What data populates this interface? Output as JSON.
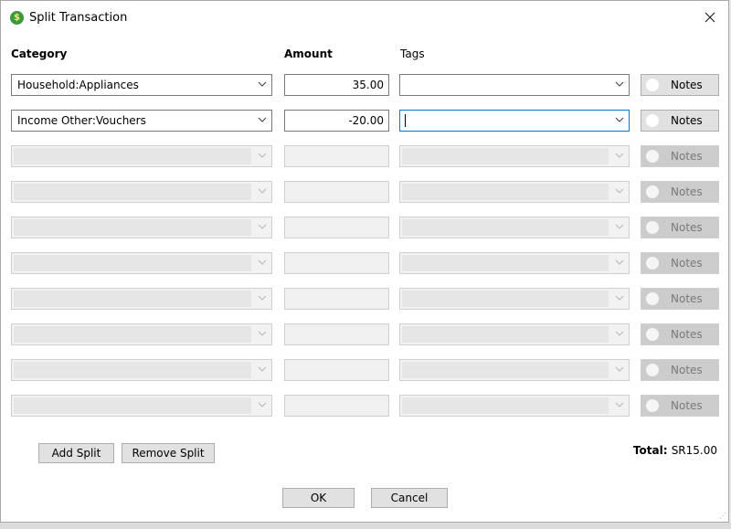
{
  "window": {
    "title": "Split Transaction",
    "icon": "dollar-coin-icon"
  },
  "headers": {
    "category": "Category",
    "amount": "Amount",
    "tags": "Tags"
  },
  "rows": [
    {
      "category": "Household:Appliances",
      "amount": "35.00",
      "tags": "",
      "notes": "Notes",
      "enabled": true
    },
    {
      "category": "Income Other:Vouchers",
      "amount": "-20.00",
      "tags": "",
      "notes": "Notes",
      "enabled": true,
      "focused": true
    },
    {
      "category": "",
      "amount": "",
      "tags": "",
      "notes": "Notes",
      "enabled": false
    },
    {
      "category": "",
      "amount": "",
      "tags": "",
      "notes": "Notes",
      "enabled": false
    },
    {
      "category": "",
      "amount": "",
      "tags": "",
      "notes": "Notes",
      "enabled": false
    },
    {
      "category": "",
      "amount": "",
      "tags": "",
      "notes": "Notes",
      "enabled": false
    },
    {
      "category": "",
      "amount": "",
      "tags": "",
      "notes": "Notes",
      "enabled": false
    },
    {
      "category": "",
      "amount": "",
      "tags": "",
      "notes": "Notes",
      "enabled": false
    },
    {
      "category": "",
      "amount": "",
      "tags": "",
      "notes": "Notes",
      "enabled": false
    },
    {
      "category": "",
      "amount": "",
      "tags": "",
      "notes": "Notes",
      "enabled": false
    }
  ],
  "buttons": {
    "add_split": "Add Split",
    "remove_split": "Remove Split",
    "ok": "OK",
    "cancel": "Cancel"
  },
  "total": {
    "label": "Total:",
    "value": "SR15.00"
  },
  "colors": {
    "accent": "#0078d7",
    "button_face": "#e1e1e1",
    "disabled_notes": "#cccccc"
  }
}
